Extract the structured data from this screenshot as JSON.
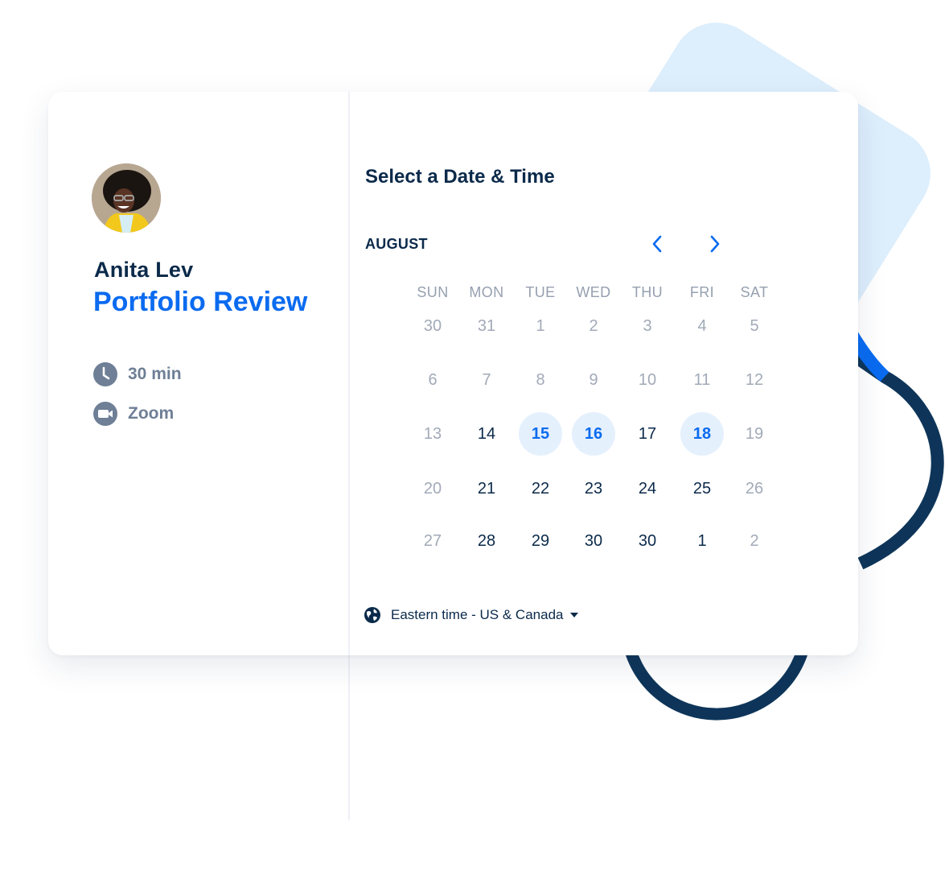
{
  "colors": {
    "primary_blue": "#0a6bf0",
    "navy": "#0b2a4a",
    "muted_gray": "#a2aab8",
    "icon_gray": "#6e7f96",
    "available_bg": "#e5f0fd",
    "decor_light_blue": "#ddeefc",
    "decor_navy": "#0e3559"
  },
  "host": {
    "name": "Anita Lev",
    "avatar": "avatar-photo"
  },
  "event": {
    "title": "Portfolio Review",
    "details": [
      {
        "icon": "clock-icon",
        "label": "30 min"
      },
      {
        "icon": "video-camera-icon",
        "label": "Zoom"
      }
    ]
  },
  "scheduler": {
    "title": "Select a Date & Time",
    "month": "AUGUST",
    "prev_label": "‹",
    "next_label": "›",
    "weekdays": [
      "SUN",
      "MON",
      "TUE",
      "WED",
      "THU",
      "FRI",
      "SAT"
    ],
    "weeks": [
      [
        {
          "d": "30",
          "state": "muted"
        },
        {
          "d": "31",
          "state": "muted"
        },
        {
          "d": "1",
          "state": "muted"
        },
        {
          "d": "2",
          "state": "muted"
        },
        {
          "d": "3",
          "state": "muted"
        },
        {
          "d": "4",
          "state": "muted"
        },
        {
          "d": "5",
          "state": "muted"
        }
      ],
      [
        {
          "d": "6",
          "state": "muted"
        },
        {
          "d": "7",
          "state": "muted"
        },
        {
          "d": "8",
          "state": "muted"
        },
        {
          "d": "9",
          "state": "muted"
        },
        {
          "d": "10",
          "state": "muted"
        },
        {
          "d": "11",
          "state": "muted"
        },
        {
          "d": "12",
          "state": "muted"
        }
      ],
      [
        {
          "d": "13",
          "state": "muted"
        },
        {
          "d": "14",
          "state": "active"
        },
        {
          "d": "15",
          "state": "available"
        },
        {
          "d": "16",
          "state": "available"
        },
        {
          "d": "17",
          "state": "active"
        },
        {
          "d": "18",
          "state": "available"
        },
        {
          "d": "19",
          "state": "muted"
        }
      ],
      [
        {
          "d": "20",
          "state": "muted"
        },
        {
          "d": "21",
          "state": "active"
        },
        {
          "d": "22",
          "state": "active"
        },
        {
          "d": "23",
          "state": "active"
        },
        {
          "d": "24",
          "state": "active"
        },
        {
          "d": "25",
          "state": "active"
        },
        {
          "d": "26",
          "state": "muted"
        }
      ],
      [
        {
          "d": "27",
          "state": "muted"
        },
        {
          "d": "28",
          "state": "active"
        },
        {
          "d": "29",
          "state": "active"
        },
        {
          "d": "30",
          "state": "active"
        },
        {
          "d": "30",
          "state": "active"
        },
        {
          "d": "1",
          "state": "active"
        },
        {
          "d": "2",
          "state": "muted"
        }
      ]
    ],
    "timezone": {
      "icon": "globe-icon",
      "label": "Eastern time - US & Canada",
      "dropdown_icon": "caret-down-icon"
    }
  }
}
